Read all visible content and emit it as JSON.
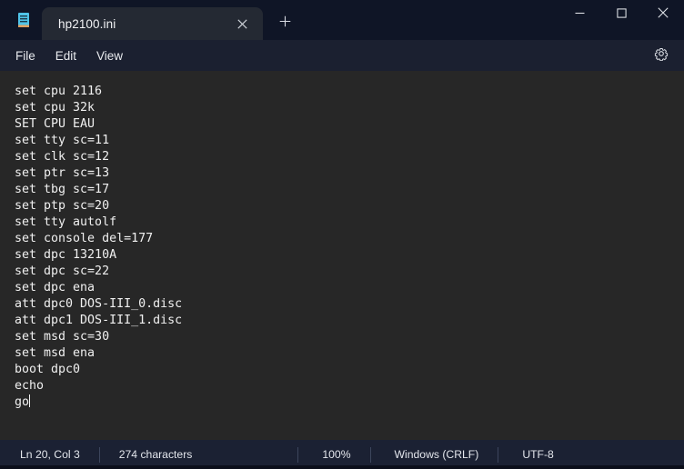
{
  "window": {
    "app_icon": "notepad-icon",
    "tab": {
      "title": "hp2100.ini",
      "close_icon": "close-icon"
    },
    "new_tab_icon": "plus-icon",
    "controls": {
      "minimize": "minimize-icon",
      "maximize": "maximize-icon",
      "close": "close-icon"
    }
  },
  "menubar": {
    "items": [
      {
        "label": "File"
      },
      {
        "label": "Edit"
      },
      {
        "label": "View"
      }
    ],
    "settings_icon": "gear-icon"
  },
  "editor": {
    "lines": [
      "set cpu 2116",
      "set cpu 32k",
      "SET CPU EAU",
      "set tty sc=11",
      "set clk sc=12",
      "set ptr sc=13",
      "set tbg sc=17",
      "set ptp sc=20",
      "set tty autolf",
      "set console del=177",
      "set dpc 13210A",
      "set dpc sc=22",
      "set dpc ena",
      "att dpc0 DOS-III_0.disc",
      "att dpc1 DOS-III_1.disc",
      "set msd sc=30",
      "set msd ena",
      "boot dpc0",
      "echo",
      "go"
    ],
    "text_color": "#f0f0f0",
    "background": "#272727"
  },
  "statusbar": {
    "position": "Ln 20, Col 3",
    "characters": "274 characters",
    "zoom": "100%",
    "line_ending": "Windows (CRLF)",
    "encoding": "UTF-8"
  },
  "colors": {
    "titlebar": "#0f1526",
    "tab_active": "#242933",
    "menubar": "#1b2030",
    "statusbar": "#1b2133"
  }
}
